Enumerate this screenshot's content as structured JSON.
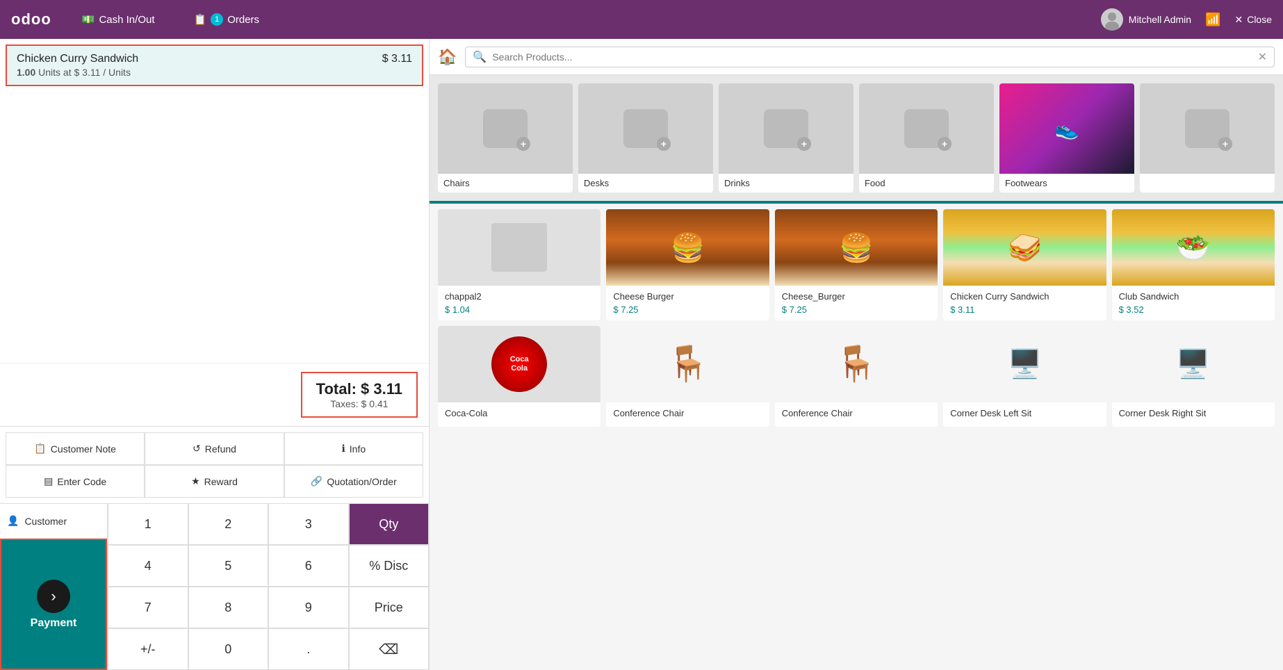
{
  "header": {
    "logo": "odoo",
    "nav": [
      {
        "id": "cash",
        "icon": "💵",
        "label": "Cash In/Out"
      },
      {
        "id": "orders",
        "icon": "📋",
        "label": "Orders",
        "badge": "1"
      }
    ],
    "user": "Mitchell Admin",
    "close_label": "Close"
  },
  "order": {
    "items": [
      {
        "name": "Chicken Curry Sandwich",
        "price": "$ 3.11",
        "qty": "1.00",
        "unit": "Units",
        "unit_price": "3.11"
      }
    ],
    "total_label": "Total:",
    "total": "$ 3.11",
    "taxes_label": "Taxes:",
    "taxes": "$ 0.41"
  },
  "actions": {
    "row1": [
      {
        "id": "customer-note",
        "icon": "📋",
        "label": "Customer Note"
      },
      {
        "id": "refund",
        "icon": "↺",
        "label": "Refund"
      },
      {
        "id": "info",
        "icon": "ℹ",
        "label": "Info"
      }
    ],
    "row2": [
      {
        "id": "enter-code",
        "icon": "▤",
        "label": "Enter Code"
      },
      {
        "id": "reward",
        "icon": "★",
        "label": "Reward"
      },
      {
        "id": "quotation",
        "icon": "🔗",
        "label": "Quotation/Order"
      }
    ]
  },
  "numpad": {
    "keys": [
      "1",
      "2",
      "3",
      "Qty",
      "4",
      "5",
      "6",
      "% Disc",
      "7",
      "8",
      "9",
      "Price",
      "+/-",
      "0",
      ".",
      "⌫"
    ],
    "active_key": "Qty"
  },
  "customer": {
    "label": "Customer"
  },
  "payment": {
    "label": "Payment"
  },
  "products": {
    "search_placeholder": "Search Products...",
    "categories": [
      {
        "id": "chairs",
        "label": "Chairs",
        "has_image": false
      },
      {
        "id": "desks",
        "label": "Desks",
        "has_image": false
      },
      {
        "id": "drinks",
        "label": "Drinks",
        "has_image": false
      },
      {
        "id": "food",
        "label": "Food",
        "has_image": false
      },
      {
        "id": "footwears",
        "label": "Footwears",
        "has_image": true
      },
      {
        "id": "misc",
        "label": "",
        "has_image": false
      }
    ],
    "items": [
      {
        "id": "chappal2",
        "name": "chappal2",
        "price": "$ 1.04",
        "image_type": "placeholder"
      },
      {
        "id": "cheese-burger",
        "name": "Cheese Burger",
        "price": "$ 7.25",
        "image_type": "burger"
      },
      {
        "id": "cheese-burger2",
        "name": "Cheese_Burger",
        "price": "$ 7.25",
        "image_type": "burger"
      },
      {
        "id": "chicken-curry",
        "name": "Chicken Curry Sandwich",
        "price": "$ 3.11",
        "image_type": "sandwich"
      },
      {
        "id": "club-sandwich",
        "name": "Club Sandwich",
        "price": "$ 3.52",
        "image_type": "sandwich2"
      },
      {
        "id": "coca-cola",
        "name": "Coca-Cola",
        "price": "",
        "image_type": "cola"
      },
      {
        "id": "conf-chair1",
        "name": "Conference Chair",
        "price": "",
        "image_type": "chair"
      },
      {
        "id": "conf-chair2",
        "name": "Conference Chair",
        "price": "",
        "image_type": "chair"
      },
      {
        "id": "corner-desk-left",
        "name": "Corner Desk Left Sit",
        "price": "",
        "image_type": "desk"
      },
      {
        "id": "corner-desk-right",
        "name": "Corner Desk Right Sit",
        "price": "",
        "image_type": "desk"
      }
    ]
  }
}
